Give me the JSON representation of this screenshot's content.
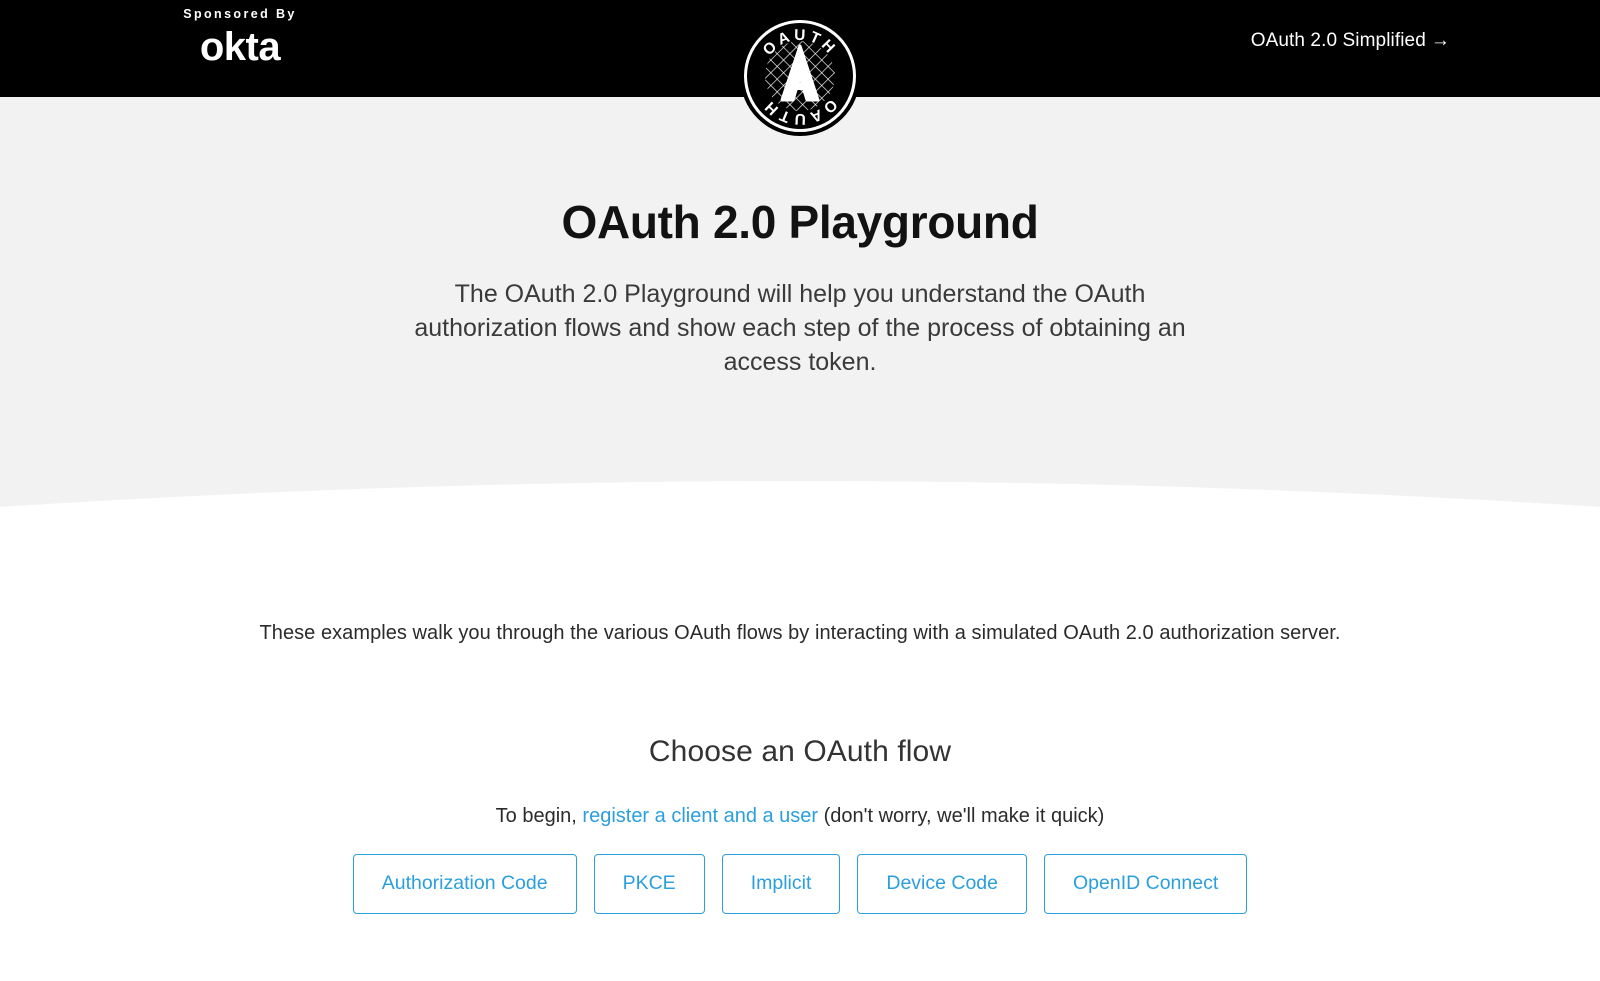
{
  "topbar": {
    "sponsor_label": "Sponsored By",
    "sponsor_brand": "okta",
    "simplified_link": "OAuth 2.0 Simplified",
    "simplified_arrow": "→",
    "badge_text_top": "OAUTH",
    "badge_text_bottom": "OAUTH",
    "badge_letter": "A",
    "background_color": "#000000"
  },
  "hero": {
    "title": "OAuth 2.0 Playground",
    "subtitle": "The OAuth 2.0 Playground will help you understand the OAuth authorization flows and show each step of the process of obtaining an access token.",
    "background_color": "#f2f2f2"
  },
  "main": {
    "intro": "These examples walk you through the various OAuth flows by interacting with a simulated OAuth 2.0 authorization server.",
    "choose_heading": "Choose an OAuth flow",
    "begin_prefix": "To begin, ",
    "begin_link": "register a client and a user",
    "begin_suffix": " (don't worry, we'll make it quick)",
    "link_color": "#2b9fdd",
    "flows": [
      {
        "label": "Authorization Code"
      },
      {
        "label": "PKCE"
      },
      {
        "label": "Implicit"
      },
      {
        "label": "Device Code"
      },
      {
        "label": "OpenID Connect"
      }
    ]
  }
}
